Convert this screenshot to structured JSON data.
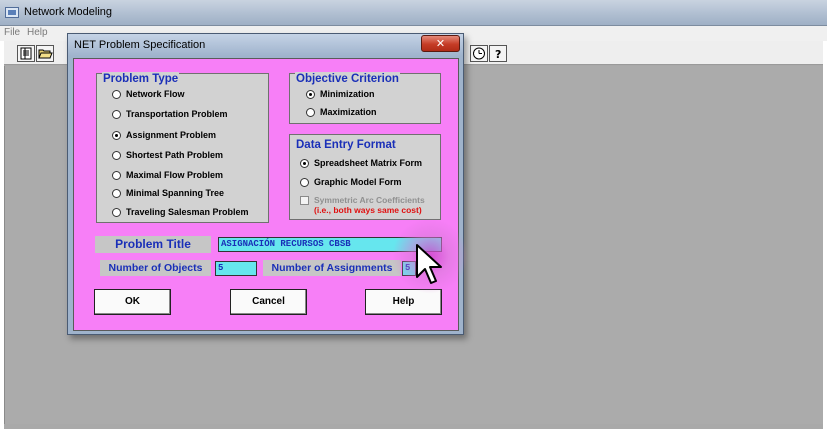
{
  "app": {
    "title": "Network Modeling",
    "menu": [
      "File",
      "Help"
    ]
  },
  "toolbar": {
    "icons": [
      "new-document-icon",
      "open-folder-icon",
      "clock-icon",
      "help-icon"
    ]
  },
  "dialog": {
    "title": "NET Problem Specification",
    "close_symbol": "✕",
    "problem_type": {
      "title": "Problem Type",
      "options": [
        {
          "label": "Network Flow",
          "checked": false
        },
        {
          "label": "Transportation Problem",
          "checked": false
        },
        {
          "label": "Assignment Problem",
          "checked": true
        },
        {
          "label": "Shortest Path Problem",
          "checked": false
        },
        {
          "label": "Maximal Flow Problem",
          "checked": false
        },
        {
          "label": "Minimal Spanning Tree",
          "checked": false
        },
        {
          "label": "Traveling Salesman Problem",
          "checked": false
        }
      ]
    },
    "objective": {
      "title": "Objective Criterion",
      "options": [
        {
          "label": "Minimization",
          "checked": true
        },
        {
          "label": "Maximization",
          "checked": false
        }
      ]
    },
    "data_entry": {
      "title": "Data Entry Format",
      "options": [
        {
          "label": "Spreadsheet Matrix Form",
          "checked": true
        },
        {
          "label": "Graphic Model Form",
          "checked": false
        }
      ],
      "symmetric_label": "Symmetric Arc Coefficients",
      "symmetric_note": "(i.e., both ways same cost)",
      "symmetric_checked": false
    },
    "problem_title_label": "Problem Title",
    "problem_title_value": "ASIGNACIÓN RECURSOS CBSB",
    "num_objects_label": "Number of Objects",
    "num_objects_value": "5",
    "num_assignments_label": "Number of Assignments",
    "num_assignments_value": "5",
    "buttons": {
      "ok": "OK",
      "cancel": "Cancel",
      "help": "Help"
    }
  },
  "colors": {
    "dialog_body": "#f77ff7",
    "label_blue": "#1a2fb8",
    "input_cyan": "#66e6ee",
    "warning_red": "#e01010"
  }
}
